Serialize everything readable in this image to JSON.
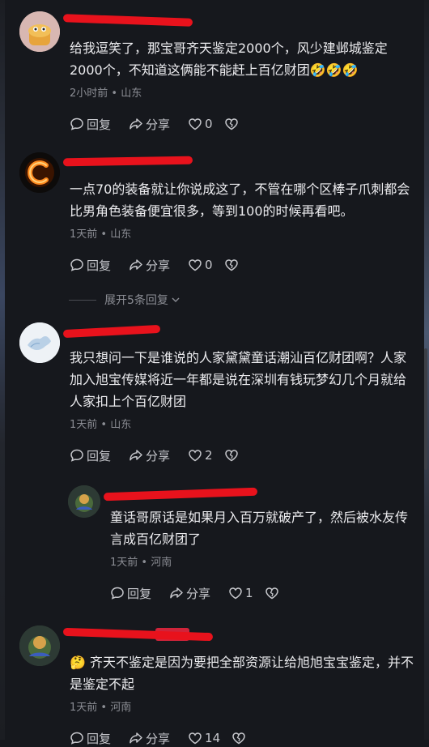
{
  "comments": [
    {
      "text": "给我逗笑了，那宝哥齐天鉴定2000个，风少建邺城鉴定2000个，不知道这俩能不能赶上百亿财团🤣🤣🤣",
      "time": "2小时前",
      "location": "山东",
      "reply_label": "回复",
      "share_label": "分享",
      "likes": "0",
      "avatar": "bread-character-avatar"
    },
    {
      "text": "一点70的装备就让你说成这了，不管在哪个区棒子爪刺都会比男角色装备便宜很多，等到100的时候再看吧。",
      "time": "1天前",
      "location": "山东",
      "reply_label": "回复",
      "share_label": "分享",
      "likes": "0",
      "avatar": "flaming-c-avatar"
    },
    {
      "text": "我只想问一下是谁说的人家黛黛童话潮汕百亿财团啊？人家加入旭宝传媒将近一年都是说在深圳有钱玩梦幻几个月就给人家扣上个百亿财团",
      "time": "1天前",
      "location": "山东",
      "reply_label": "回复",
      "share_label": "分享",
      "likes": "2",
      "avatar": "map-avatar"
    },
    {
      "text": "童话哥原话是如果月入百万就破产了，然后被水友传言成百亿财团了",
      "time": "1天前",
      "location": "河南",
      "reply_label": "回复",
      "share_label": "分享",
      "likes": "1",
      "avatar": "game-character-avatar"
    },
    {
      "text": "🤔 齐天不鉴定是因为要把全部资源让给旭旭宝宝鉴定，并不是鉴定不起",
      "time": "1天前",
      "location": "河南",
      "reply_label": "回复",
      "share_label": "分享",
      "likes": "14",
      "avatar": "game-character-avatar"
    }
  ],
  "expand_replies": "展开5条回复",
  "colors": {
    "redaction": "#e8121c",
    "background": "#16181d"
  }
}
